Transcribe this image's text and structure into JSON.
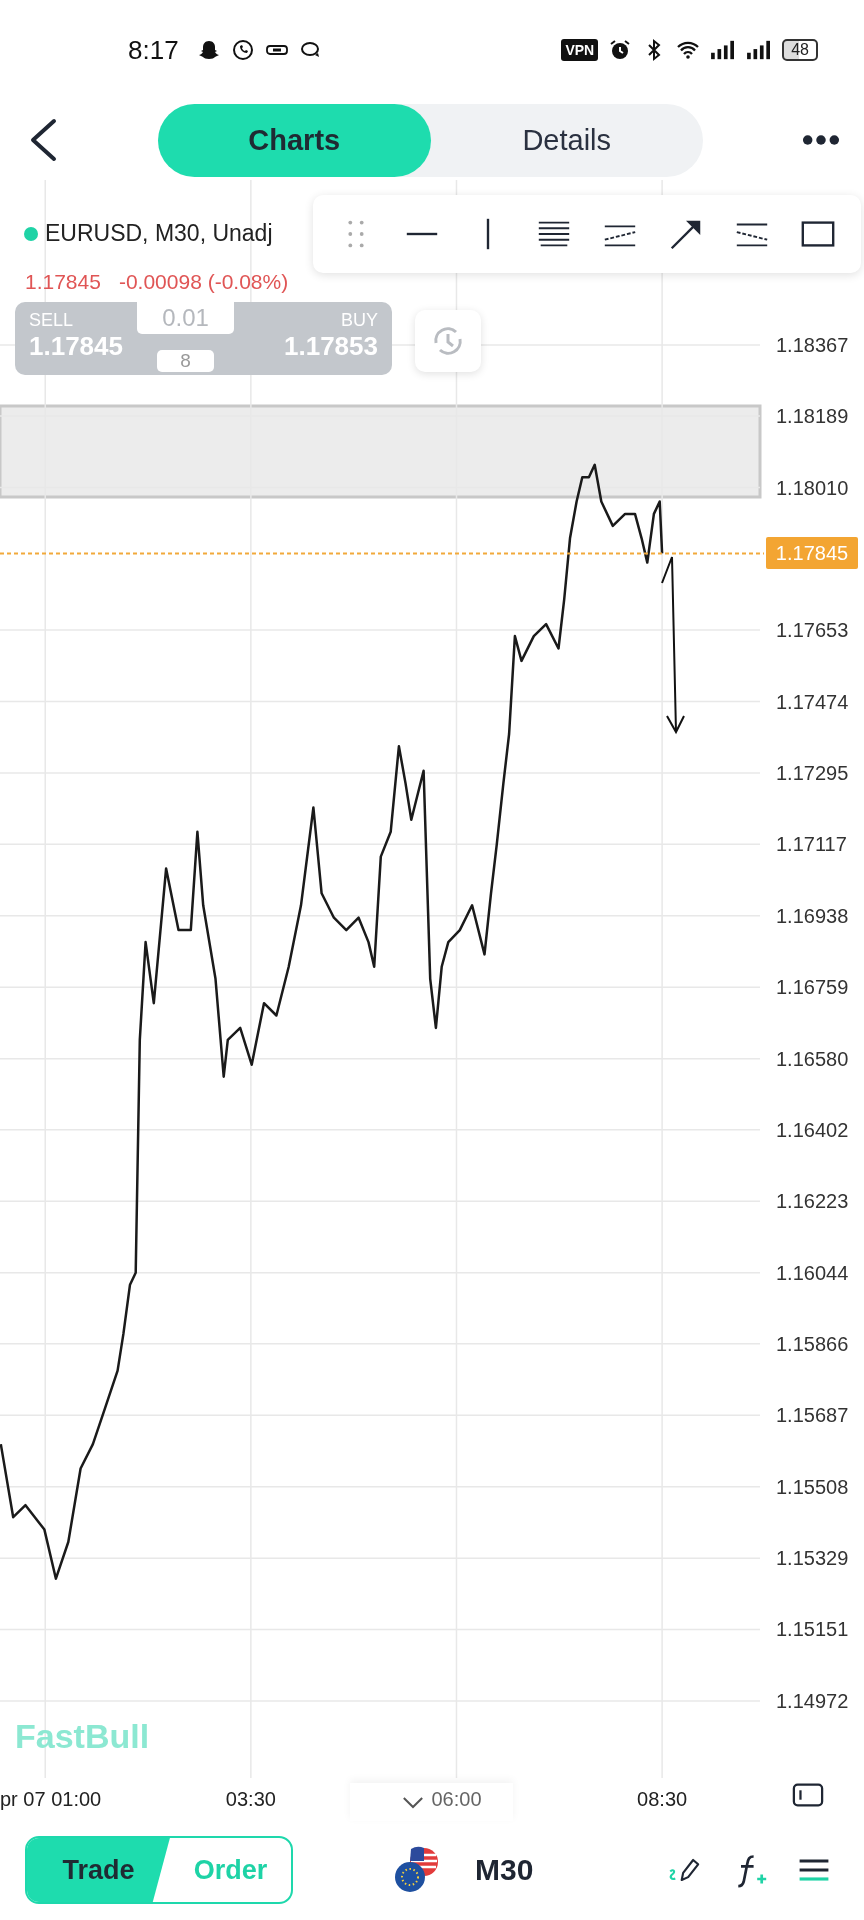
{
  "status_bar": {
    "time": "8:17",
    "vpn": "VPN",
    "battery": "48"
  },
  "header": {
    "tabs": [
      {
        "label": "Charts",
        "selected": true
      },
      {
        "label": "Details",
        "selected": false
      }
    ]
  },
  "legend": {
    "symbol": "EURUSD, M30, Unadj",
    "price": "1.17845",
    "change": "-0.00098 (-0.08%)"
  },
  "trade_panel": {
    "sell_label": "SELL",
    "sell_price": "1.17845",
    "lot": "0.01",
    "spread": "8",
    "buy_label": "BUY",
    "buy_price": "1.17853"
  },
  "chart": {
    "current_price": "1.17845",
    "watermark": "FastBull",
    "chart_data": {
      "type": "line",
      "grid": true,
      "xlim": [
        0.45,
        9.69
      ],
      "ylim": [
        1.14779,
        1.1878
      ],
      "x": [
        0.46,
        0.61,
        0.76,
        0.99,
        1.13,
        1.28,
        1.43,
        1.58,
        1.73,
        1.88,
        1.95,
        2.03,
        2.1,
        2.15,
        2.22,
        2.32,
        2.47,
        2.62,
        2.77,
        2.85,
        2.92,
        3.07,
        3.17,
        3.22,
        3.37,
        3.51,
        3.66,
        3.81,
        3.96,
        4.11,
        4.26,
        4.36,
        4.51,
        4.66,
        4.81,
        4.93,
        5.0,
        5.08,
        5.2,
        5.3,
        5.38,
        5.45,
        5.6,
        5.68,
        5.75,
        5.82,
        5.9,
        6.04,
        6.19,
        6.34,
        6.42,
        6.49,
        6.57,
        6.64,
        6.71,
        6.79,
        6.94,
        7.09,
        7.24,
        7.31,
        7.38,
        7.46,
        7.53,
        7.61,
        7.68,
        7.76,
        7.9,
        8.05,
        8.17,
        8.25,
        8.32,
        8.4,
        8.47,
        8.5
      ],
      "series": [
        {
          "color": "#1a1a1a",
          "values": [
            1.15615,
            1.15432,
            1.15462,
            1.15401,
            1.15278,
            1.1537,
            1.15554,
            1.15615,
            1.15707,
            1.15799,
            1.15891,
            1.16014,
            1.16044,
            1.16627,
            1.16872,
            1.16719,
            1.17056,
            1.16902,
            1.16902,
            1.17148,
            1.16964,
            1.1678,
            1.16535,
            1.16627,
            1.16657,
            1.16565,
            1.16719,
            1.16688,
            1.1681,
            1.16964,
            1.17209,
            1.16994,
            1.16933,
            1.16902,
            1.16933,
            1.16872,
            1.1681,
            1.17086,
            1.17148,
            1.17362,
            1.1727,
            1.17178,
            1.17301,
            1.1678,
            1.16657,
            1.1681,
            1.16872,
            1.16902,
            1.16964,
            1.16841,
            1.16994,
            1.17117,
            1.1727,
            1.17393,
            1.17638,
            1.17576,
            1.17638,
            1.17668,
            1.17607,
            1.1773,
            1.17883,
            1.17975,
            1.18036,
            1.18036,
            1.18067,
            1.17975,
            1.17914,
            1.17944,
            1.17944,
            1.17883,
            1.17822,
            1.17944,
            1.17975,
            1.17845
          ]
        }
      ],
      "xticks": [
        {
          "value": 1,
          "label": "pr 07 01:00"
        },
        {
          "value": 3.5,
          "label": "03:30"
        },
        {
          "value": 6,
          "label": "06:00"
        },
        {
          "value": 8.5,
          "label": "08:30"
        }
      ],
      "yticks": [
        {
          "value": 1.18367,
          "label": "1.18367"
        },
        {
          "value": 1.18189,
          "label": "1.18189"
        },
        {
          "value": 1.1801,
          "label": "1.18010"
        },
        {
          "value": 1.17653,
          "label": "1.17653"
        },
        {
          "value": 1.17474,
          "label": "1.17474"
        },
        {
          "value": 1.17295,
          "label": "1.17295"
        },
        {
          "value": 1.17117,
          "label": "1.17117"
        },
        {
          "value": 1.16938,
          "label": "1.16938"
        },
        {
          "value": 1.16759,
          "label": "1.16759"
        },
        {
          "value": 1.1658,
          "label": "1.16580"
        },
        {
          "value": 1.16402,
          "label": "1.16402"
        },
        {
          "value": 1.16223,
          "label": "1.16223"
        },
        {
          "value": 1.16044,
          "label": "1.16044"
        },
        {
          "value": 1.15866,
          "label": "1.15866"
        },
        {
          "value": 1.15687,
          "label": "1.15687"
        },
        {
          "value": 1.15508,
          "label": "1.15508"
        },
        {
          "value": 1.15329,
          "label": "1.15329"
        },
        {
          "value": 1.15151,
          "label": "1.15151"
        },
        {
          "value": 1.14972,
          "label": "1.14972"
        }
      ]
    }
  },
  "bottom_bar": {
    "modes": [
      {
        "label": "Trade",
        "selected": true
      },
      {
        "label": "Order",
        "selected": false
      }
    ],
    "timeframe": "M30"
  }
}
